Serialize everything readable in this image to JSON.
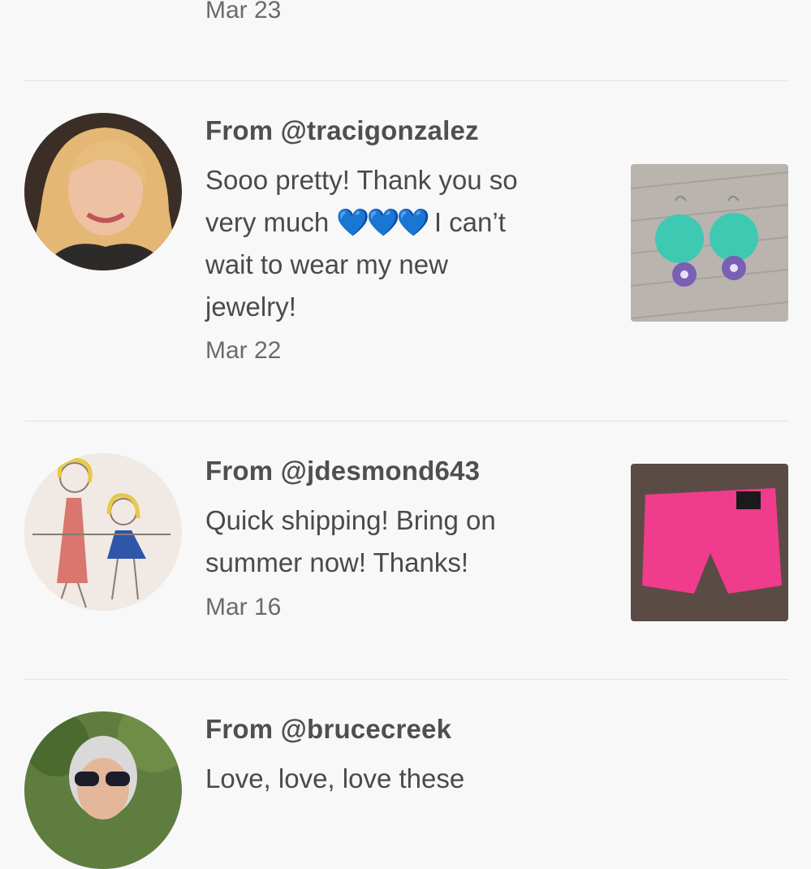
{
  "top_review": {
    "date": "Mar 23"
  },
  "reviews": [
    {
      "from": "From @tracigonzalez",
      "message_lines": [
        "Sooo pretty! Thank you so",
        "very much",
        "💙💙💙",
        "I can’t",
        "wait to wear my new",
        "jewelry!"
      ],
      "date": "Mar 22"
    },
    {
      "from": "From @jdesmond643",
      "message_lines": [
        "Quick shipping! Bring on",
        "summer now! Thanks!"
      ],
      "date": "Mar 16"
    },
    {
      "from": "From @brucecreek",
      "message_lines": [
        "Love, love, love these"
      ]
    }
  ],
  "colors": {
    "background": "#f8f8f8",
    "divider": "#e3e3e3",
    "heart": "#1e9be8"
  }
}
